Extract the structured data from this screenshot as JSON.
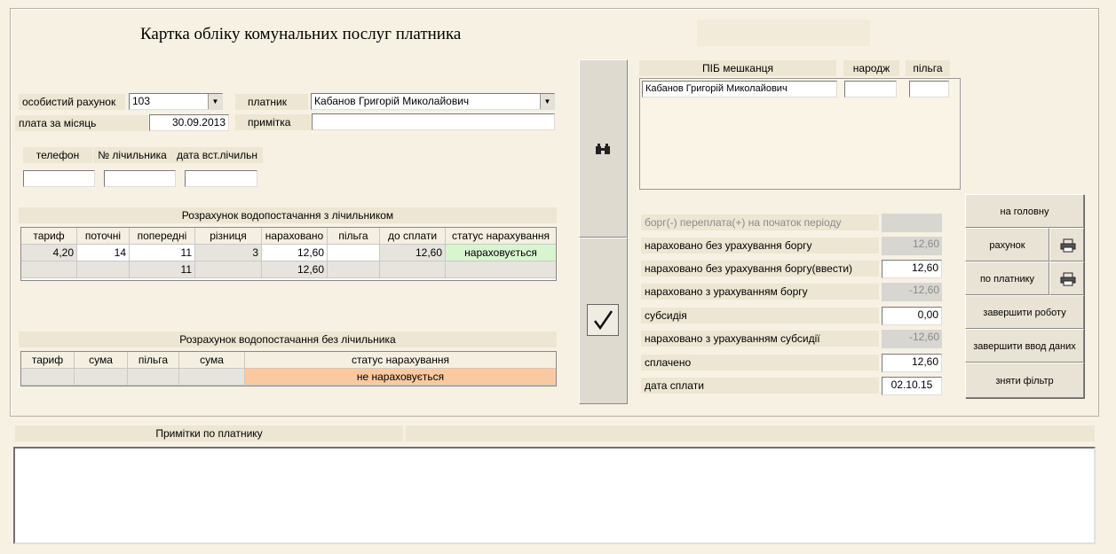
{
  "title": "Картка обліку комунальних послуг платника",
  "header": {
    "account_label": "особистий рахунок",
    "account_value": "103",
    "payer_label": "платник",
    "payer_value": "Кабанов Григорій Миколайович",
    "month_label": "плата за місяць",
    "month_value": "30.09.2013",
    "note_label": "примітка",
    "note_value": ""
  },
  "meter_info": {
    "phone_label": "телефон",
    "meter_no_label": "№ лічильника",
    "install_date_label": "дата вст.лічильн",
    "phone_value": "",
    "meter_no_value": "",
    "install_date_value": ""
  },
  "metered": {
    "title": "Розрахунок водопостачання з лічильником",
    "columns": [
      "тариф",
      "поточні",
      "попередні",
      "різниця",
      "нараховано",
      "пільга",
      "до сплати",
      "статус нарахування"
    ],
    "row1": [
      "4,20",
      "14",
      "11",
      "3",
      "12,60",
      "",
      "12,60",
      "нараховується"
    ],
    "row2": [
      "",
      "",
      "11",
      "",
      "12,60",
      "",
      "",
      ""
    ]
  },
  "unmetered": {
    "title": "Розрахунок водопостачання без лічильника",
    "columns": [
      "тариф",
      "сума",
      "пільга",
      "сума",
      "статус нарахування"
    ],
    "row1": [
      "",
      "",
      "",
      "",
      "не нараховується"
    ]
  },
  "residents": {
    "name_header": "ПІБ мешканця",
    "birth_header": "народж",
    "benefit_header": "пільга",
    "name": "Кабанов Григорій Миколайович",
    "birth": "",
    "benefit": ""
  },
  "summary": {
    "debt_label": "борг(-) переплата(+) на початок періоду",
    "debt_value": "",
    "charged_no_debt_label": "нараховано без урахування боргу",
    "charged_no_debt_value": "12,60",
    "charged_no_debt_input_label": "нараховано без урахування боргу(ввести)",
    "charged_no_debt_input_value": "12,60",
    "charged_with_debt_label": "нараховано з урахуванням боргу",
    "charged_with_debt_value": "-12,60",
    "subsidy_label": "субсидія",
    "subsidy_value": "0,00",
    "charged_with_subsidy_label": "нараховано з урахуванням субсидії",
    "charged_with_subsidy_value": "-12,60",
    "paid_label": "сплачено",
    "paid_value": "12,60",
    "pay_date_label": "дата сплати",
    "pay_date_value": "02.10.15"
  },
  "buttons": {
    "home": "на головну",
    "invoice": "рахунок",
    "by_payer": "по платнику",
    "finish": "завершити роботу",
    "finish_input": "завершити ввод даних",
    "remove_filter": "зняти фільтр"
  },
  "notes": {
    "label": "Примітки по платнику",
    "value": ""
  },
  "colors": {
    "background": "#f7f1e3",
    "label_bg": "#ece6d2",
    "status_active": "#d9f5d0",
    "status_inactive": "#fbc9a0"
  }
}
